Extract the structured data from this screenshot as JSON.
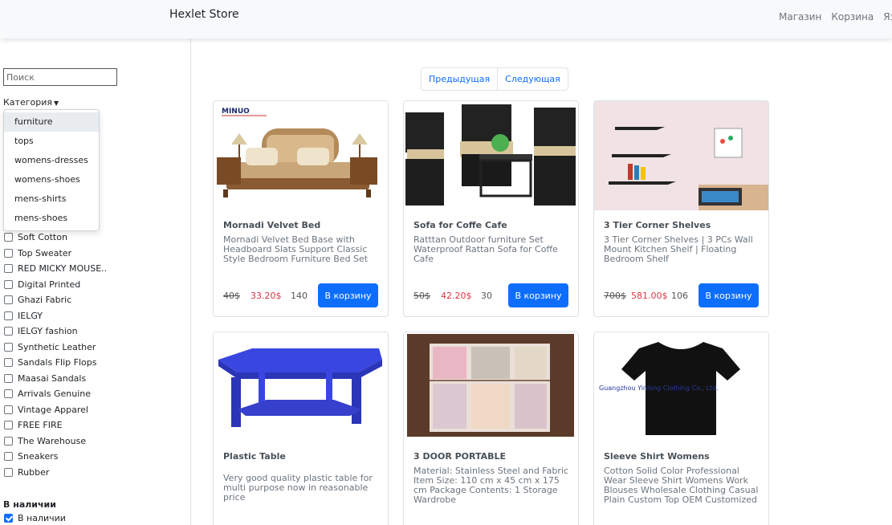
{
  "navbar": {
    "brand": "Hexlet Store",
    "links": [
      "Магазин",
      "Корзина",
      "Язык"
    ]
  },
  "sidebar": {
    "search_placeholder": "Поиск",
    "category_label": "Категория",
    "categories": [
      {
        "label": "furniture",
        "active": true
      },
      {
        "label": "tops",
        "active": false
      },
      {
        "label": "womens-dresses",
        "active": false
      },
      {
        "label": "womens-shoes",
        "active": false
      },
      {
        "label": "mens-shirts",
        "active": false
      },
      {
        "label": "mens-shoes",
        "active": false
      }
    ],
    "brands": [
      "Soft Cotton",
      "Top Sweater",
      "RED MICKY MOUSE..",
      "Digital Printed",
      "Ghazi Fabric",
      "IELGY",
      "IELGY fashion",
      "Synthetic Leather",
      "Sandals Flip Flops",
      "Maasai Sandals",
      "Arrivals Genuine",
      "Vintage Apparel",
      "FREE FIRE",
      "The Warehouse",
      "Sneakers",
      "Rubber"
    ],
    "stock_title": "В наличии",
    "stock_checkbox_label": "В наличии",
    "stock_checked": true
  },
  "pager": {
    "prev": "Предыдущая",
    "next": "Следующая"
  },
  "products": [
    {
      "title": "Mornadi Velvet Bed",
      "desc": "Mornadi Velvet Bed Base with Headboard Slats Support Classic Style Bedroom Furniture Bed Set",
      "old_price": "40$",
      "new_price": "33.20$",
      "stock": "140",
      "button": "В корзину",
      "logo_text": "MINUO"
    },
    {
      "title": "Sofa for Coffe Cafe",
      "desc": "Ratttan Outdoor furniture Set Waterproof Rattan Sofa for Coffe Cafe",
      "old_price": "50$",
      "new_price": "42.20$",
      "stock": "30",
      "button": "В корзину"
    },
    {
      "title": "3 Tier Corner Shelves",
      "desc": "3 Tier Corner Shelves | 3 PCs Wall Mount Kitchen Shelf | Floating Bedroom Shelf",
      "old_price": "700$",
      "new_price": "581.00$",
      "stock": "106",
      "button": "В корзину"
    },
    {
      "title": "Plastic Table",
      "desc": "Very good quality plastic table for multi purpose now in reasonable price"
    },
    {
      "title": "3 DOOR PORTABLE",
      "desc": "Material: Stainless Steel and Fabric Item Size: 110 cm x 45 cm x 175 cm Package Contents: 1 Storage Wardrobe"
    },
    {
      "title": "Sleeve Shirt Womens",
      "desc": "Cotton Solid Color Professional Wear Sleeve Shirt Womens Work Blouses Wholesale Clothing Casual Plain Custom Top OEM Customized",
      "image_caption": "Guangzhou Yinlong Clothing Co., Ltd."
    }
  ],
  "colors": {
    "primary": "#0d6efd",
    "sale": "#dc3545",
    "muted": "#6c757d"
  }
}
